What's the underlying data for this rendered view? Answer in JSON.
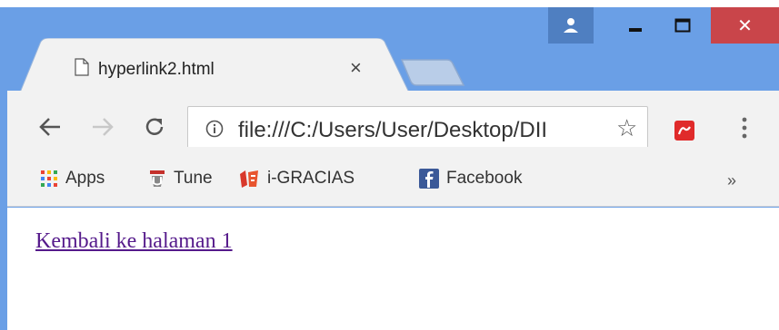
{
  "tab": {
    "title": "hyperlink2.html",
    "close_glyph": "×"
  },
  "toolbar": {
    "url": "file:///C:/Users/User/Desktop/DII",
    "star_glyph": "☆"
  },
  "bookmarks": {
    "items": [
      {
        "label": "Apps",
        "icon": "apps-grid-icon"
      },
      {
        "label": "Tune",
        "icon": "tune-icon"
      },
      {
        "label": "i-GRACIAS",
        "icon": "igracias-icon"
      },
      {
        "label": "Facebook",
        "icon": "facebook-icon"
      }
    ],
    "more_glyph": "»"
  },
  "window": {
    "close_glyph": "✕"
  },
  "page": {
    "link_text": "Kembali ke halaman 1"
  },
  "colors": {
    "frame": "#6a9fe6",
    "close_red": "#c9454a",
    "link_visited": "#551a8b"
  }
}
